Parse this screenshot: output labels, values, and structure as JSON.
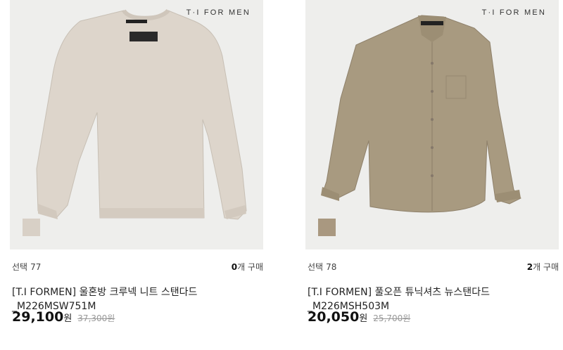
{
  "products": [
    {
      "brand": "T·I FOR MEN",
      "swatch_color": "#d8d0c6",
      "garment_color": "#ddd5cb",
      "garment_type": "crewneck-knit",
      "select_label": "선택",
      "select_count": "77",
      "buy_count": "0",
      "buy_suffix": "개 구매",
      "title": "[T.I FORMEN] 울혼방 크루넥 니트 스탠다드 \n_M226MSW751M",
      "price": "29,100",
      "currency": "원",
      "original_price": "37,300원"
    },
    {
      "brand": "T·I FOR MEN",
      "swatch_color": "#a99880",
      "garment_color": "#a89a80",
      "garment_type": "button-shirt",
      "select_label": "선택",
      "select_count": "78",
      "buy_count": "2",
      "buy_suffix": "개 구매",
      "title": "[T.I FORMEN] 풀오픈 튜닉셔츠 뉴스탠다드\n_M226MSH503M",
      "price": "20,050",
      "currency": "원",
      "original_price": "25,700원"
    }
  ]
}
